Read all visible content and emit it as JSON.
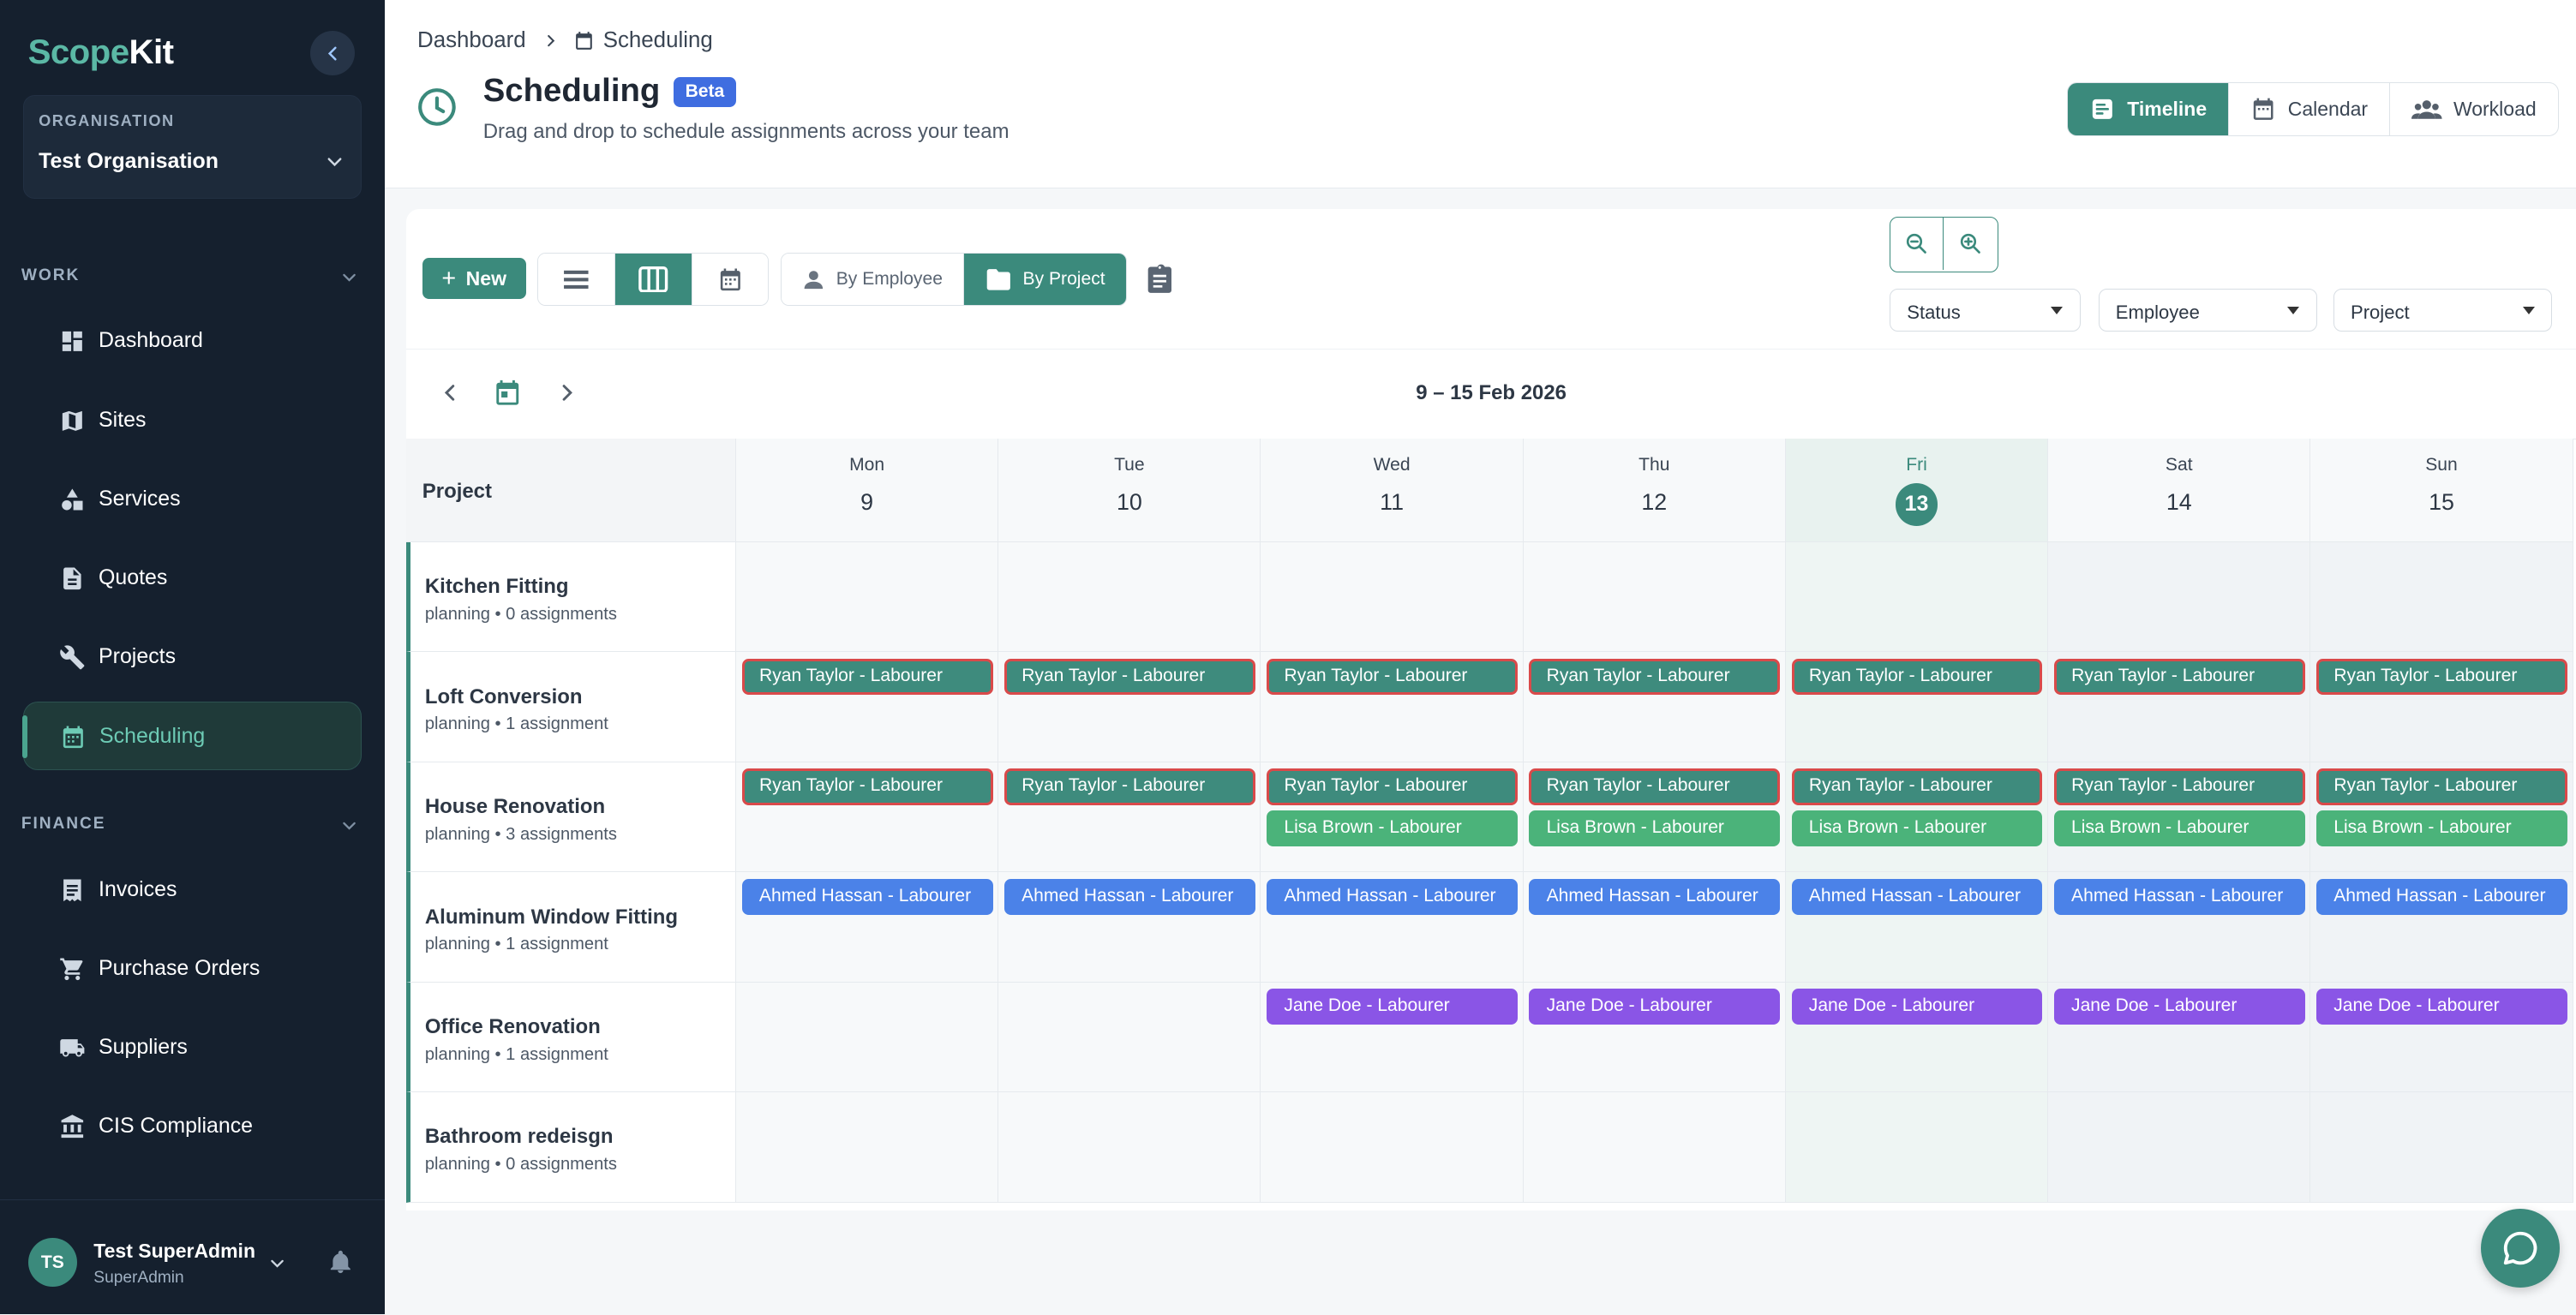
{
  "sidebar": {
    "logo_part1": "Scope",
    "logo_part2": "Kit",
    "org_label": "ORGANISATION",
    "org_name": "Test Organisation",
    "work_label": "WORK",
    "finance_label": "FINANCE",
    "work_items": [
      {
        "label": "Dashboard",
        "icon": "dashboard-icon"
      },
      {
        "label": "Sites",
        "icon": "map-icon"
      },
      {
        "label": "Services",
        "icon": "shapes-icon"
      },
      {
        "label": "Quotes",
        "icon": "document-icon"
      },
      {
        "label": "Projects",
        "icon": "wrench-icon"
      },
      {
        "label": "Scheduling",
        "icon": "calendar-icon",
        "active": true
      }
    ],
    "finance_items": [
      {
        "label": "Invoices",
        "icon": "receipt-icon"
      },
      {
        "label": "Purchase Orders",
        "icon": "cart-icon"
      },
      {
        "label": "Suppliers",
        "icon": "truck-icon"
      },
      {
        "label": "CIS Compliance",
        "icon": "bank-icon"
      }
    ],
    "user": {
      "initials": "TS",
      "name": "Test SuperAdmin",
      "role": "SuperAdmin"
    }
  },
  "header": {
    "breadcrumb": [
      "Dashboard",
      "Scheduling"
    ],
    "title": "Scheduling",
    "badge": "Beta",
    "subtitle": "Drag and drop to schedule assignments across your team",
    "views": [
      {
        "label": "Timeline",
        "active": true
      },
      {
        "label": "Calendar",
        "active": false
      },
      {
        "label": "Workload",
        "active": false
      }
    ]
  },
  "toolbar": {
    "new_label": "New",
    "group_by": [
      {
        "label": "By Employee",
        "active": false
      },
      {
        "label": "By Project",
        "active": true
      }
    ],
    "filters": [
      "Status",
      "Employee",
      "Project"
    ]
  },
  "range_label": "9 – 15 Feb 2026",
  "grid": {
    "project_header": "Project",
    "days": [
      {
        "name": "Mon",
        "num": "9"
      },
      {
        "name": "Tue",
        "num": "10"
      },
      {
        "name": "Wed",
        "num": "11"
      },
      {
        "name": "Thu",
        "num": "12"
      },
      {
        "name": "Fri",
        "num": "13",
        "today": true
      },
      {
        "name": "Sat",
        "num": "14",
        "weekend": true
      },
      {
        "name": "Sun",
        "num": "15",
        "weekend": true
      }
    ],
    "rows": [
      {
        "name": "Kitchen Fitting",
        "meta": "planning • 0 assignments",
        "bars": []
      },
      {
        "name": "Loft Conversion",
        "meta": "planning • 1 assignment",
        "bars": [
          {
            "label": "Ryan Taylor - Labourer",
            "kind": "ryan",
            "days": [
              0,
              1,
              2,
              3,
              4,
              5,
              6
            ],
            "slot": 0
          }
        ]
      },
      {
        "name": "House Renovation",
        "meta": "planning • 3 assignments",
        "bars": [
          {
            "label": "Ryan Taylor - Labourer",
            "kind": "ryan",
            "days": [
              0,
              1,
              2,
              3,
              4,
              5,
              6
            ],
            "slot": 0
          },
          {
            "label": "Lisa Brown - Labourer",
            "kind": "lisa",
            "days": [
              2,
              3,
              4,
              5,
              6
            ],
            "slot": 1
          }
        ]
      },
      {
        "name": "Aluminum Window Fitting",
        "meta": "planning • 1 assignment",
        "bars": [
          {
            "label": "Ahmed Hassan - Labourer",
            "kind": "ahmed",
            "days": [
              0,
              1,
              2,
              3,
              4,
              5,
              6
            ],
            "slot": 0
          }
        ]
      },
      {
        "name": "Office Renovation",
        "meta": "planning • 1 assignment",
        "bars": [
          {
            "label": "Jane Doe - Labourer",
            "kind": "jane",
            "days": [
              2,
              3,
              4,
              5,
              6
            ],
            "slot": 0
          }
        ]
      },
      {
        "name": "Bathroom redeisgn",
        "meta": "planning • 0 assignments",
        "bars": []
      }
    ]
  },
  "colors": {
    "accent": "#3b8a7c",
    "conflict_border": "#d94a4a",
    "lisa": "#4bb37a",
    "ahmed": "#4b82e8",
    "jane": "#8a55e6"
  }
}
